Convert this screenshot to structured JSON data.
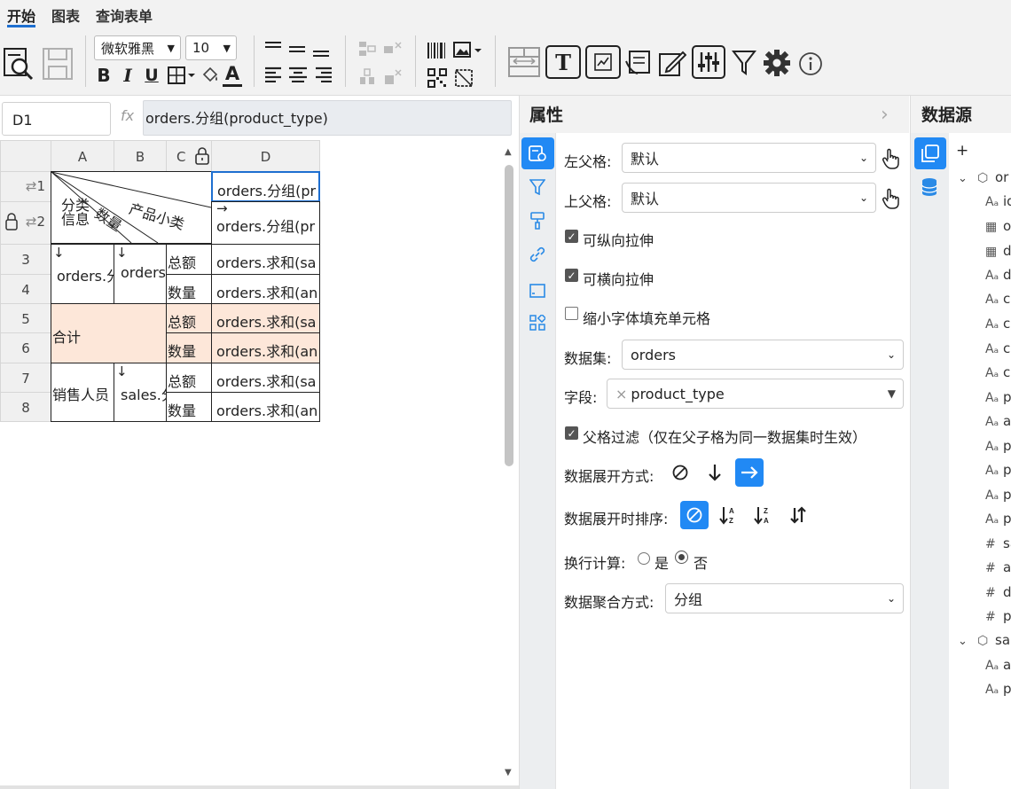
{
  "tabs": [
    {
      "label": "开始"
    },
    {
      "label": "图表"
    },
    {
      "label": "查询表单"
    }
  ],
  "toolbar": {
    "font_family": "微软雅黑",
    "font_size": "10",
    "bold": "B",
    "italic": "I",
    "underline": "U",
    "text_color": "A",
    "text_tool": "T"
  },
  "formula_bar": {
    "cell_ref": "D1",
    "fx": "fx",
    "formula": "orders.分组(product_type)"
  },
  "grid": {
    "columns": [
      "A",
      "B",
      "C",
      "D"
    ],
    "rows": [
      "1",
      "2",
      "3",
      "4",
      "5",
      "6",
      "7",
      "8"
    ],
    "header_cell": {
      "label1": "产品小类",
      "label2": "数量",
      "label3": "分类信息"
    },
    "cells": {
      "d1": "orders.分组(pr",
      "d2_arrow": "→",
      "d2": "orders.分组(pr",
      "a3_arrow": "↓",
      "a3": "orders.分",
      "b3_arrow": "↓",
      "b3": "orders",
      "c3": "总额",
      "d3": "orders.求和(sa",
      "c4": "数量",
      "d4": "orders.求和(an",
      "a5": "合计",
      "c5": "总额",
      "d5": "orders.求和(sa",
      "c6": "数量",
      "d6": "orders.求和(an",
      "a7": "销售人员",
      "b7_arrow": "↓",
      "b7": "sales.分",
      "c7": "总额",
      "d7": "orders.求和(sa",
      "c8": "数量",
      "d8": "orders.求和(an"
    }
  },
  "properties": {
    "title": "属性",
    "left_parent_label": "左父格:",
    "left_parent_value": "默认",
    "top_parent_label": "上父格:",
    "top_parent_value": "默认",
    "vertical_stretch": {
      "label": "可纵向拉伸",
      "checked": true
    },
    "horizontal_stretch": {
      "label": "可横向拉伸",
      "checked": true
    },
    "shrink_font": {
      "label": "缩小字体填充单元格",
      "checked": false
    },
    "dataset_label": "数据集:",
    "dataset_value": "orders",
    "field_label": "字段:",
    "field_value": "product_type",
    "field_clear": "×",
    "parent_filter": {
      "label": "父格过滤（仅在父子格为同一数据集时生效）",
      "checked": true
    },
    "expand_mode_label": "数据展开方式:",
    "expand_mode_selected": "horizontal",
    "expand_sort_label": "数据展开时排序:",
    "expand_sort_selected": "none",
    "line_calc_label": "换行计算:",
    "line_calc_yes": "是",
    "line_calc_no": "否",
    "line_calc_selected": "否",
    "aggregate_label": "数据聚合方式:",
    "aggregate_value": "分组"
  },
  "datasource": {
    "title": "数据源",
    "add": "+",
    "items": [
      {
        "icon": "cube-icon",
        "label": "or"
      },
      {
        "icon": "text-icon",
        "label": "id"
      },
      {
        "icon": "calendar-icon",
        "label": "o"
      },
      {
        "icon": "calendar-icon",
        "label": "d"
      },
      {
        "icon": "text-icon",
        "label": "d"
      },
      {
        "icon": "text-icon",
        "label": "c"
      },
      {
        "icon": "text-icon",
        "label": "c"
      },
      {
        "icon": "text-icon",
        "label": "c"
      },
      {
        "icon": "text-icon",
        "label": "c"
      },
      {
        "icon": "text-icon",
        "label": "p"
      },
      {
        "icon": "text-icon",
        "label": "a"
      },
      {
        "icon": "text-icon",
        "label": "p"
      },
      {
        "icon": "text-icon",
        "label": "p"
      },
      {
        "icon": "text-icon",
        "label": "p"
      },
      {
        "icon": "text-icon",
        "label": "p"
      },
      {
        "icon": "number-icon",
        "label": "sa"
      },
      {
        "icon": "number-icon",
        "label": "a"
      },
      {
        "icon": "number-icon",
        "label": "d"
      },
      {
        "icon": "number-icon",
        "label": "p"
      },
      {
        "icon": "cube-icon",
        "label": "sa"
      },
      {
        "icon": "text-icon",
        "label": "a"
      },
      {
        "icon": "text-icon",
        "label": "p"
      }
    ],
    "text_glyph": "Aₐ",
    "number_glyph": "#"
  }
}
